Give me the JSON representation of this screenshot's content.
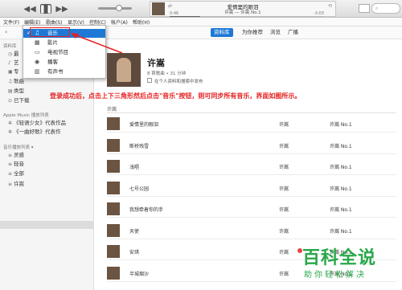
{
  "player": {
    "song_title": "爱情里的眼泪",
    "song_sub": "许嵩 — 许嵩 No.1",
    "elapsed": "0:46",
    "remaining": "-3:03",
    "progress": 0.2
  },
  "menubar": [
    "文件(F)",
    "编辑(E)",
    "歌曲(S)",
    "显示(V)",
    "控制(C)",
    "帐户(A)",
    "帮助(H)"
  ],
  "nav_tabs": [
    {
      "label": "资料库",
      "active": true
    },
    {
      "label": "为你推荐",
      "active": false
    },
    {
      "label": "浏览",
      "active": false
    },
    {
      "label": "广播",
      "active": false
    }
  ],
  "sidebar": {
    "library_head": "资料库",
    "library_items": [
      {
        "icon": "clock-icon",
        "label": "最"
      },
      {
        "icon": "mic-icon",
        "label": "艺"
      },
      {
        "icon": "album-icon",
        "label": "专"
      },
      {
        "icon": "note-icon",
        "label": "歌曲"
      },
      {
        "icon": "video-icon",
        "label": "类型"
      },
      {
        "icon": "download-icon",
        "label": "已下载"
      }
    ],
    "apple_head": "Apple Music 播放列表",
    "apple_items": [
      "《轻语少女》代表作品",
      "《一曲好歌》代表作"
    ],
    "playlists_head": "音乐播放列表 ▾",
    "playlist_items": [
      "灵感",
      "轻音",
      "全部",
      "许嵩"
    ]
  },
  "popup_menu": {
    "items": [
      {
        "icon": "music-icon",
        "label": "音乐",
        "selected": true
      },
      {
        "icon": "film-icon",
        "label": "影片",
        "selected": false
      },
      {
        "icon": "tv-icon",
        "label": "电视节目",
        "selected": false
      },
      {
        "icon": "podcast-icon",
        "label": "播客",
        "selected": false
      },
      {
        "icon": "book-icon",
        "label": "有声书",
        "selected": false
      }
    ]
  },
  "album": {
    "artist": "许嵩",
    "meta": "8 首歌曲 • 31 分钟",
    "checkbox_label": "在个人资料和搜索中发布"
  },
  "instruction": "登录成功后，点击上下三角形然后点击\"音乐\"按钮，则可同步所有音乐，界面如图所示。",
  "table": {
    "header": "许嵩",
    "rows": [
      {
        "name": "爱情里的眼泪",
        "artist": "许嵩",
        "album": "许嵩 No.1"
      },
      {
        "name": "断桥残雪",
        "artist": "许嵩",
        "album": "许嵩 No.1"
      },
      {
        "name": "浅唱",
        "artist": "许嵩",
        "album": "许嵩 No.1"
      },
      {
        "name": "七号公园",
        "artist": "许嵩",
        "album": "许嵩 No.1"
      },
      {
        "name": "我想牵着你的手",
        "artist": "许嵩",
        "album": "许嵩 No.1"
      },
      {
        "name": "天使",
        "artist": "许嵩",
        "album": "许嵩 No.1"
      },
      {
        "name": "安琪",
        "artist": "许嵩",
        "album": "许嵩 No.1"
      },
      {
        "name": "半城烟沙",
        "artist": "许嵩",
        "album": "许嵩 No.1"
      }
    ]
  },
  "watermark": {
    "title": "百科全说",
    "subtitle": "助你轻松解决"
  }
}
